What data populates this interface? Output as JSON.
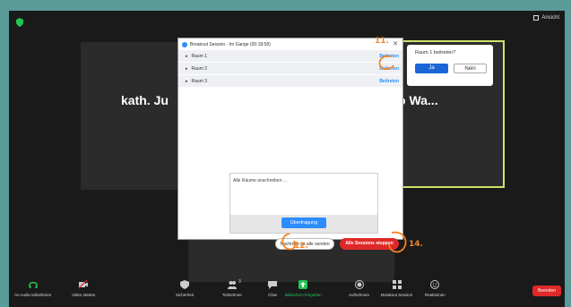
{
  "header": {
    "view_label": "Ansicht"
  },
  "tiles": {
    "left_name": "kath. Ju",
    "right_name": "o  Wa..."
  },
  "dialog": {
    "title": "Breakout Session - Im Gange (00:18:58)",
    "rooms": [
      {
        "name": "Raum 1",
        "action": "Beitreten"
      },
      {
        "name": "Raum 2",
        "action": "Beitreten"
      },
      {
        "name": "Raum 3",
        "action": "Beitreten"
      }
    ],
    "broadcast_placeholder": "Alle Räume anschreiben ...",
    "broadcast_button": "Übertragung",
    "message_all_button": "Nachricht an alle senden",
    "close_all_button": "Alle Sessions stoppen"
  },
  "popup": {
    "question": "Raum 1 beitreten?",
    "yes": "Ja",
    "no": "Nein"
  },
  "annotations": [
    "11.",
    "12.",
    "14."
  ],
  "toolbar": {
    "items": [
      {
        "label": "An Audio teilnehmen"
      },
      {
        "label": "Video starten"
      },
      {
        "label": "Sicherheit"
      },
      {
        "label": "Teilnehmer",
        "count": "3"
      },
      {
        "label": "Chat"
      },
      {
        "label": "Bildschirm freigeben"
      },
      {
        "label": "Aufnehmen"
      },
      {
        "label": "Breakout Session"
      },
      {
        "label": "Reaktionen"
      }
    ],
    "end_label": "Beenden"
  },
  "colors": {
    "accent": "#2d8cff",
    "danger": "#e02828",
    "share": "#23c552",
    "annotation": "#f5821f",
    "highlight_border": "#cfe26a"
  }
}
